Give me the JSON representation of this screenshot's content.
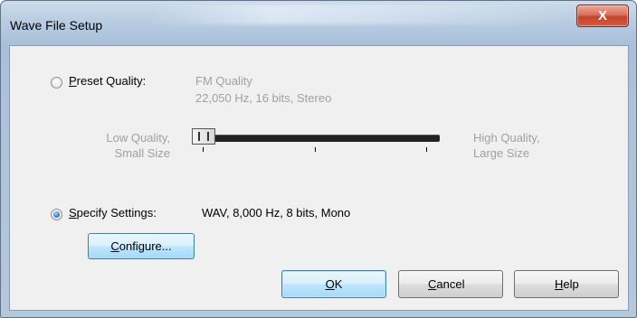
{
  "window": {
    "title": "Wave File Setup",
    "close_label": "X"
  },
  "preset": {
    "label_accel": "P",
    "label_rest": "reset Quality:",
    "selected": false,
    "quality_name": "FM Quality",
    "quality_desc": "22,050 Hz, 16 bits, Stereo"
  },
  "slider": {
    "low_line1": "Low Quality,",
    "low_line2": "Small Size",
    "high_line1": "High Quality,",
    "high_line2": "Large Size",
    "value_fraction": 0.0
  },
  "specify": {
    "label_accel": "S",
    "label_rest": "pecify Settings:",
    "selected": true,
    "value": "WAV, 8,000 Hz, 8 bits, Mono"
  },
  "buttons": {
    "configure_accel": "C",
    "configure_rest": "onfigure...",
    "ok_accel": "O",
    "ok_rest": "K",
    "cancel_accel": "C",
    "cancel_rest": "ancel",
    "help_accel": "H",
    "help_rest": "elp"
  }
}
